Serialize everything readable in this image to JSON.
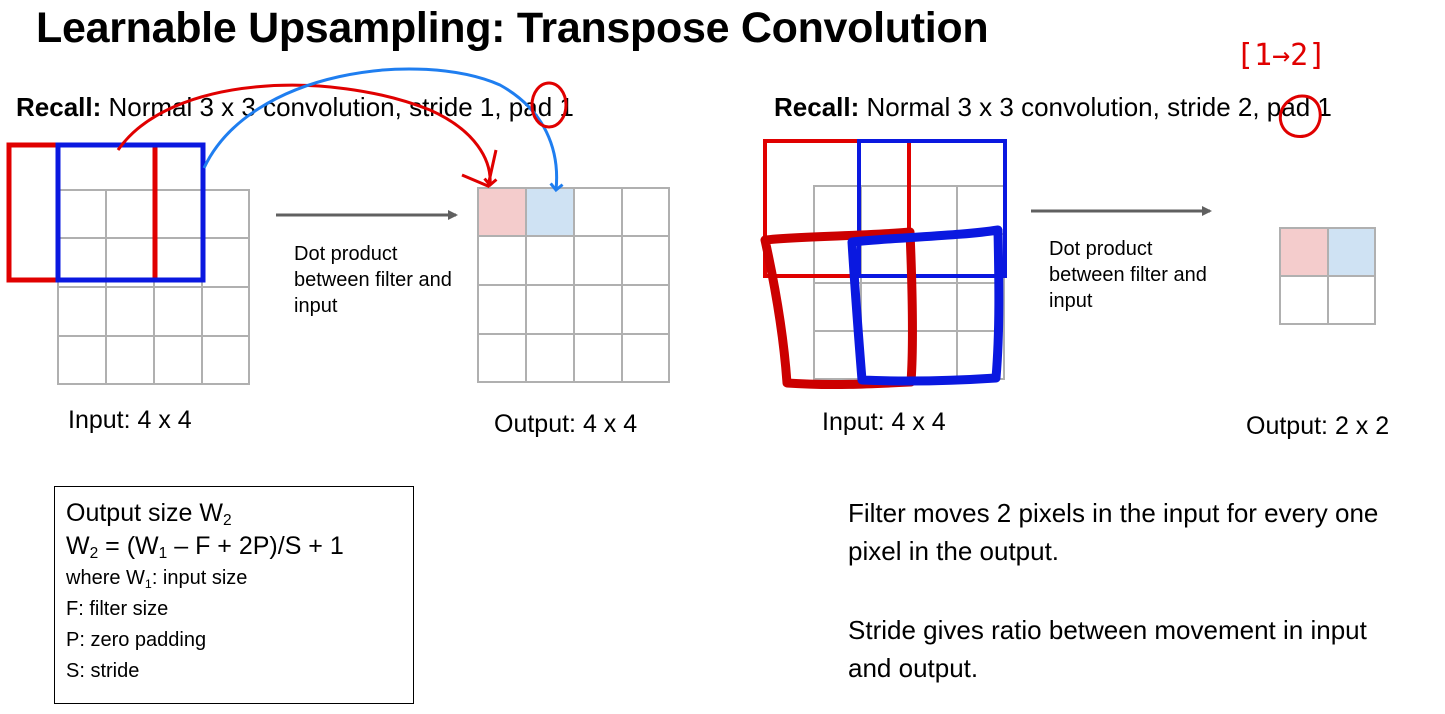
{
  "title": "Learnable Upsampling: Transpose Convolution",
  "left": {
    "recall_bold": "Recall:",
    "recall_text": " Normal 3 x 3 convolution, stride 1, pad 1",
    "dot_product": "Dot product between filter and input",
    "input_caption": "Input: 4 x 4",
    "output_caption": "Output: 4 x 4"
  },
  "right": {
    "recall_bold": "Recall:",
    "recall_text": " Normal 3 x 3 convolution, stride 2, pad 1",
    "annotation": "[1→2]",
    "dot_product": "Dot product between filter and input",
    "input_caption": "Input: 4 x 4",
    "output_caption": "Output: 2 x 2"
  },
  "formula": {
    "line1_text": "Output size W",
    "line1_sub": "2",
    "line2_a": "W",
    "line2_a_sub": "2",
    "line2_b": " = (W",
    "line2_b_sub": "1",
    "line2_c": " – F + 2P)/S + 1",
    "line3_a": "where W",
    "line3_sub": "1",
    "line3_b": ": input size",
    "line4": "F: filter size",
    "line5": "P: zero padding",
    "line6": "S: stride"
  },
  "notes": {
    "note1": "Filter moves 2 pixels in the input for every one pixel in the output.",
    "note2": "Stride gives ratio between movement in input and output."
  },
  "colors": {
    "red": "#e00000",
    "blue": "#0a18e0",
    "arrow_blue": "#1f7ef0",
    "grid": "#b0b0b0",
    "arrow_gray": "#606060",
    "cell_red": "#f4cccc",
    "cell_blue": "#cfe2f3"
  }
}
